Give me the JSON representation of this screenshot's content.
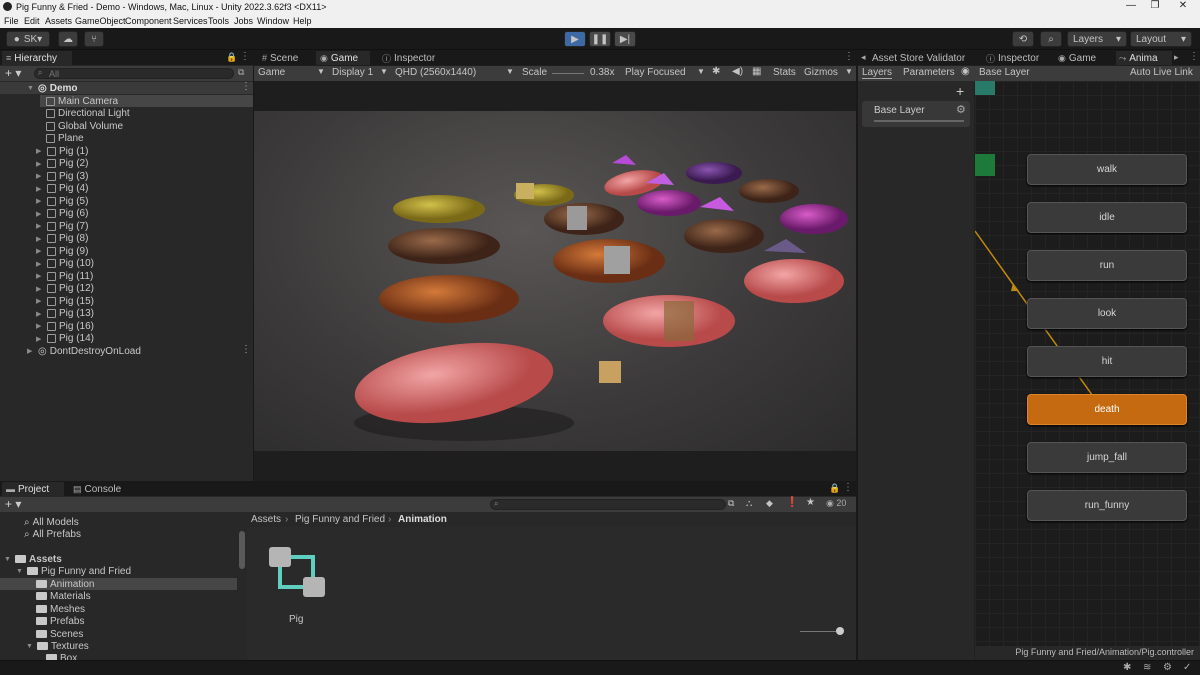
{
  "window": {
    "title": "Pig Funny & Fried - Demo - Windows, Mac, Linux - Unity 2022.3.62f3 <DX11>"
  },
  "menu": [
    "File",
    "Edit",
    "Assets",
    "GameObject",
    "Component",
    "Services",
    "Tools",
    "Jobs",
    "Window",
    "Help"
  ],
  "toolbar": {
    "account": "SK",
    "layers": "Layers",
    "layout": "Layout"
  },
  "hierarchy": {
    "tab": "Hierarchy",
    "search_placeholder": "All",
    "scene": "Demo",
    "items": [
      "Main Camera",
      "Directional Light",
      "Global Volume",
      "Plane",
      "Pig (1)",
      "Pig (2)",
      "Pig (3)",
      "Pig (4)",
      "Pig (5)",
      "Pig (6)",
      "Pig (7)",
      "Pig (8)",
      "Pig (9)",
      "Pig (10)",
      "Pig (11)",
      "Pig (12)",
      "Pig (15)",
      "Pig (13)",
      "Pig (16)",
      "Pig (14)"
    ],
    "dontdestroy": "DontDestroyOnLoad"
  },
  "center_tabs": {
    "scene": "Scene",
    "game": "Game",
    "inspector": "Inspector"
  },
  "game_bar": {
    "mode": "Game",
    "display": "Display 1",
    "resolution": "QHD (2560x1440)",
    "scale_label": "Scale",
    "scale_value": "0.38x",
    "play_focused": "Play Focused",
    "stats": "Stats",
    "gizmos": "Gizmos"
  },
  "right_tabs": {
    "validator": "Asset Store Validator",
    "inspector": "Inspector",
    "game": "Game",
    "animator": "Anima"
  },
  "animator": {
    "layers_tab": "Layers",
    "params_tab": "Parameters",
    "breadcrumb": "Base Layer",
    "live_link": "Auto Live Link",
    "layer_name": "Base Layer",
    "states": [
      "walk",
      "idle",
      "run",
      "look",
      "hit",
      "death",
      "jump_fall",
      "run_funny"
    ],
    "footer_path": "Pig Funny and Fried/Animation/Pig.controller"
  },
  "project": {
    "tab": "Project",
    "console_tab": "Console",
    "favorites": [
      "All Models",
      "All Prefabs"
    ],
    "assets": "Assets",
    "folder_root": "Pig Funny and Fried",
    "subfolders": [
      "Animation",
      "Materials",
      "Meshes",
      "Prefabs",
      "Scenes",
      "Textures"
    ],
    "texture_child": "Box",
    "breadcrumb": [
      "Assets",
      "Pig Funny and Fried",
      "Animation"
    ],
    "asset_name": "Pig",
    "count": "20"
  },
  "colors": {
    "accent_blue": "#3d6aa5",
    "death_orange": "#c56a10",
    "teal": "#5fd0c0"
  }
}
